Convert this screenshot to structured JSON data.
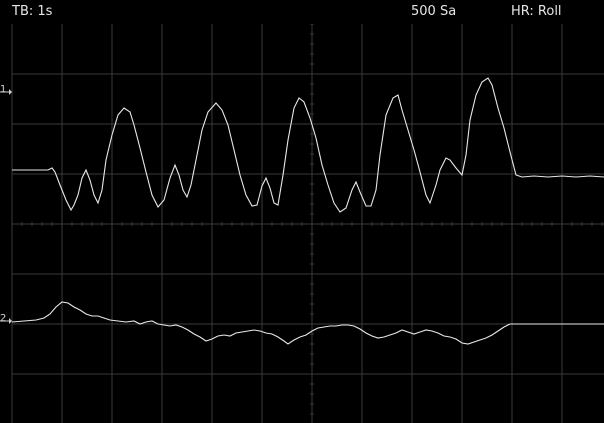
{
  "status_bar": {
    "timebase": "TB: 1s",
    "sample_rate": "500 Sa",
    "horizontal_mode": "HR: Roll"
  },
  "channels": [
    {
      "label": "1",
      "color": "#e8e8e8"
    },
    {
      "label": "2",
      "color": "#e8e8e8"
    }
  ],
  "colors": {
    "background": "#000000",
    "grid": "#3a3a3a",
    "text": "#e6e6e6",
    "marker": "#cfcfcf"
  }
}
